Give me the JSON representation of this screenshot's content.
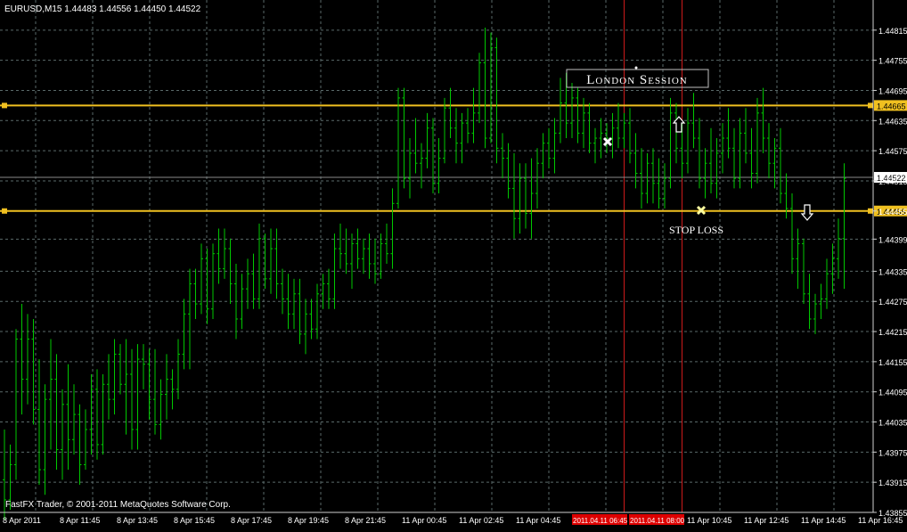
{
  "window": {
    "symbol_header": "EURUSD,M15  1.44483 1.44556 1.44450 1.44522",
    "copyright": "FastFX Trader, © 2001-2011 MetaQuotes Software Corp."
  },
  "colors": {
    "background": "#000000",
    "bars": "#00c800",
    "grid": "#5a6a6a",
    "horizontal_lines": "#f0c020",
    "vertical_lines": "#cc1a1a",
    "axis_text": "#ffffff",
    "highlight_bg": "#dd0000"
  },
  "annotations": {
    "session_label": "London Session",
    "stop_loss_label": "STOP LOSS",
    "cross_marker_1": "white-x-icon",
    "cross_marker_2": "yellow-x-icon",
    "arrow_up": "arrow-up-icon",
    "arrow_down": "arrow-down-icon"
  },
  "chart_data": {
    "type": "ohlc",
    "symbol": "EURUSD",
    "timeframe": "M15",
    "header_values": {
      "open": 1.44483,
      "high": 1.44556,
      "low": 1.4445,
      "close": 1.44522
    },
    "price_ticks": [
      "1.44815",
      "1.44755",
      "1.44695",
      "1.44635",
      "1.44575",
      "1.44515",
      "1.44455",
      "1.44399",
      "1.44335",
      "1.44275",
      "1.44215",
      "1.44155",
      "1.44095",
      "1.44035",
      "1.43975",
      "1.43915",
      "1.43855"
    ],
    "price_range": [
      1.43855,
      1.44875
    ],
    "time_ticks": [
      "8 Apr 2011",
      "8 Apr 11:45",
      "8 Apr 13:45",
      "8 Apr 15:45",
      "8 Apr 17:45",
      "8 Apr 19:45",
      "8 Apr 21:45",
      "11 Apr 00:45",
      "11 Apr 02:45",
      "11 Apr 04:45",
      "2011.04.11 06:45",
      "2011.04.11 08:00",
      "11 Apr 10:45",
      "11 Apr 12:45",
      "11 Apr 14:45",
      "11 Apr 16:45"
    ],
    "horizontal_lines": [
      {
        "price": 1.44665,
        "label": "1.44665"
      },
      {
        "price": 1.44455,
        "label": "1.44455"
      }
    ],
    "current_price": {
      "price": 1.44522,
      "label": "1.44522"
    },
    "vertical_lines": [
      {
        "bar": 107
      },
      {
        "bar": 117
      }
    ],
    "grid": true,
    "bars": [
      [
        1.4392,
        1.4402,
        1.4384,
        1.4388
      ],
      [
        1.4388,
        1.4399,
        1.4386,
        1.4395
      ],
      [
        1.4395,
        1.4422,
        1.4392,
        1.442
      ],
      [
        1.442,
        1.4427,
        1.4405,
        1.4412
      ],
      [
        1.4412,
        1.4425,
        1.4407,
        1.442
      ],
      [
        1.442,
        1.4424,
        1.4403,
        1.4406
      ],
      [
        1.4406,
        1.4416,
        1.4391,
        1.4394
      ],
      [
        1.4394,
        1.4411,
        1.4389,
        1.4408
      ],
      [
        1.4408,
        1.442,
        1.4398,
        1.4412
      ],
      [
        1.4412,
        1.4417,
        1.4394,
        1.4398
      ],
      [
        1.4398,
        1.441,
        1.4392,
        1.4407
      ],
      [
        1.4407,
        1.4415,
        1.4394,
        1.44
      ],
      [
        1.44,
        1.4411,
        1.4397,
        1.4405
      ],
      [
        1.4405,
        1.4407,
        1.4391,
        1.4395
      ],
      [
        1.4395,
        1.4406,
        1.4394,
        1.4402
      ],
      [
        1.4402,
        1.4413,
        1.4397,
        1.441
      ],
      [
        1.441,
        1.4414,
        1.4396,
        1.4399
      ],
      [
        1.4399,
        1.4413,
        1.4397,
        1.4411
      ],
      [
        1.4411,
        1.4417,
        1.4404,
        1.4408
      ],
      [
        1.4408,
        1.442,
        1.4405,
        1.4417
      ],
      [
        1.4417,
        1.4419,
        1.4409,
        1.4411
      ],
      [
        1.4411,
        1.442,
        1.4401,
        1.4413
      ],
      [
        1.4413,
        1.4418,
        1.4398,
        1.4402
      ],
      [
        1.4402,
        1.4419,
        1.4398,
        1.4416
      ],
      [
        1.4416,
        1.4419,
        1.441,
        1.4415
      ],
      [
        1.4415,
        1.4418,
        1.4404,
        1.4408
      ],
      [
        1.4408,
        1.4418,
        1.4401,
        1.4403
      ],
      [
        1.4403,
        1.4412,
        1.44,
        1.4409
      ],
      [
        1.4409,
        1.4417,
        1.4404,
        1.4412
      ],
      [
        1.4412,
        1.4414,
        1.4406,
        1.441
      ],
      [
        1.441,
        1.442,
        1.4408,
        1.4417
      ],
      [
        1.4417,
        1.4428,
        1.4414,
        1.4425
      ],
      [
        1.4425,
        1.4434,
        1.4414,
        1.4431
      ],
      [
        1.4431,
        1.4434,
        1.4424,
        1.4427
      ],
      [
        1.4427,
        1.4439,
        1.4425,
        1.4436
      ],
      [
        1.4436,
        1.4438,
        1.4423,
        1.4426
      ],
      [
        1.4426,
        1.4439,
        1.4424,
        1.4437
      ],
      [
        1.4437,
        1.4442,
        1.4431,
        1.4434
      ],
      [
        1.4434,
        1.4442,
        1.4432,
        1.4438
      ],
      [
        1.4438,
        1.444,
        1.4427,
        1.4431
      ],
      [
        1.4431,
        1.4435,
        1.442,
        1.4424
      ],
      [
        1.4424,
        1.4433,
        1.4422,
        1.443
      ],
      [
        1.443,
        1.4436,
        1.4426,
        1.4433
      ],
      [
        1.4433,
        1.4437,
        1.4426,
        1.4428
      ],
      [
        1.4428,
        1.4443,
        1.4426,
        1.444
      ],
      [
        1.444,
        1.4441,
        1.443,
        1.4432
      ],
      [
        1.4432,
        1.4442,
        1.4429,
        1.4438
      ],
      [
        1.4438,
        1.4442,
        1.4428,
        1.4431
      ],
      [
        1.4431,
        1.4434,
        1.4425,
        1.4428
      ],
      [
        1.4428,
        1.4433,
        1.4422,
        1.4425
      ],
      [
        1.4425,
        1.4432,
        1.4422,
        1.4429
      ],
      [
        1.4429,
        1.4432,
        1.4419,
        1.4421
      ],
      [
        1.4421,
        1.4428,
        1.4417,
        1.4425
      ],
      [
        1.4425,
        1.4428,
        1.442,
        1.4422
      ],
      [
        1.4422,
        1.4431,
        1.442,
        1.4429
      ],
      [
        1.4429,
        1.4433,
        1.4426,
        1.4431
      ],
      [
        1.4431,
        1.4434,
        1.4426,
        1.4428
      ],
      [
        1.4428,
        1.4441,
        1.4426,
        1.4438
      ],
      [
        1.4438,
        1.4443,
        1.4434,
        1.4437
      ],
      [
        1.4437,
        1.4442,
        1.4433,
        1.4435
      ],
      [
        1.4435,
        1.4441,
        1.443,
        1.4439
      ],
      [
        1.4439,
        1.4442,
        1.4434,
        1.4436
      ],
      [
        1.4436,
        1.444,
        1.4433,
        1.4438
      ],
      [
        1.4438,
        1.4441,
        1.4432,
        1.4435
      ],
      [
        1.4435,
        1.444,
        1.4431,
        1.4433
      ],
      [
        1.4433,
        1.4441,
        1.4432,
        1.4439
      ],
      [
        1.4439,
        1.4443,
        1.4435,
        1.4437
      ],
      [
        1.4437,
        1.445,
        1.4434,
        1.4447
      ],
      [
        1.4447,
        1.447,
        1.4446,
        1.4468
      ],
      [
        1.4468,
        1.447,
        1.445,
        1.4452
      ],
      [
        1.4452,
        1.446,
        1.4448,
        1.4457
      ],
      [
        1.4457,
        1.4464,
        1.4453,
        1.4455
      ],
      [
        1.4455,
        1.4459,
        1.445,
        1.4456
      ],
      [
        1.4456,
        1.4465,
        1.4454,
        1.4462
      ],
      [
        1.4462,
        1.4464,
        1.4449,
        1.4451
      ],
      [
        1.4451,
        1.446,
        1.4449,
        1.4456
      ],
      [
        1.4456,
        1.4468,
        1.4455,
        1.4466
      ],
      [
        1.4466,
        1.447,
        1.446,
        1.4462
      ],
      [
        1.4462,
        1.4466,
        1.4455,
        1.4459
      ],
      [
        1.4459,
        1.4465,
        1.4455,
        1.4463
      ],
      [
        1.4463,
        1.4466,
        1.4459,
        1.4461
      ],
      [
        1.4461,
        1.447,
        1.4459,
        1.4465
      ],
      [
        1.4465,
        1.4477,
        1.4463,
        1.4475
      ],
      [
        1.4475,
        1.4482,
        1.4458,
        1.446
      ],
      [
        1.446,
        1.4481,
        1.4459,
        1.4478
      ],
      [
        1.4478,
        1.448,
        1.4455,
        1.4458
      ],
      [
        1.4458,
        1.4461,
        1.4452,
        1.4456
      ],
      [
        1.4456,
        1.4459,
        1.4448,
        1.445
      ],
      [
        1.445,
        1.4457,
        1.444,
        1.4444
      ],
      [
        1.4444,
        1.4455,
        1.4441,
        1.4452
      ],
      [
        1.4452,
        1.4455,
        1.4442,
        1.4445
      ],
      [
        1.4445,
        1.4456,
        1.444,
        1.4449
      ],
      [
        1.4449,
        1.4458,
        1.4446,
        1.4455
      ],
      [
        1.4455,
        1.4461,
        1.4452,
        1.4459
      ],
      [
        1.4459,
        1.4462,
        1.4454,
        1.4456
      ],
      [
        1.4456,
        1.4464,
        1.4453,
        1.4461
      ],
      [
        1.4461,
        1.4472,
        1.4459,
        1.4467
      ],
      [
        1.4467,
        1.4473,
        1.446,
        1.4463
      ],
      [
        1.4463,
        1.4471,
        1.446,
        1.4468
      ],
      [
        1.4468,
        1.447,
        1.4459,
        1.4461
      ],
      [
        1.4461,
        1.4468,
        1.4458,
        1.4465
      ],
      [
        1.4465,
        1.4467,
        1.4457,
        1.4459
      ],
      [
        1.4459,
        1.4462,
        1.4455,
        1.446
      ],
      [
        1.446,
        1.4464,
        1.4456,
        1.4461
      ],
      [
        1.4461,
        1.4463,
        1.4457,
        1.446
      ],
      [
        1.446,
        1.4465,
        1.4456,
        1.4462
      ],
      [
        1.4462,
        1.4467,
        1.4458,
        1.446
      ],
      [
        1.446,
        1.4465,
        1.4458,
        1.4463
      ],
      [
        1.4463,
        1.4466,
        1.4455,
        1.4457
      ],
      [
        1.4457,
        1.4461,
        1.445,
        1.4453
      ],
      [
        1.4453,
        1.4458,
        1.4446,
        1.4449
      ],
      [
        1.4449,
        1.4457,
        1.4447,
        1.4455
      ],
      [
        1.4455,
        1.4458,
        1.4447,
        1.4451
      ],
      [
        1.4451,
        1.4456,
        1.4446,
        1.4448
      ],
      [
        1.4448,
        1.4455,
        1.4446,
        1.4452
      ],
      [
        1.4452,
        1.4468,
        1.445,
        1.4465
      ],
      [
        1.4465,
        1.4467,
        1.4455,
        1.4458
      ],
      [
        1.4458,
        1.4463,
        1.4452,
        1.4455
      ],
      [
        1.4455,
        1.4466,
        1.4453,
        1.4463
      ],
      [
        1.4463,
        1.4469,
        1.4458,
        1.446
      ],
      [
        1.446,
        1.4464,
        1.445,
        1.4452
      ],
      [
        1.4452,
        1.4458,
        1.4448,
        1.4455
      ],
      [
        1.4455,
        1.4462,
        1.4449,
        1.4451
      ],
      [
        1.4451,
        1.446,
        1.4448,
        1.4457
      ],
      [
        1.4457,
        1.4463,
        1.4453,
        1.446
      ],
      [
        1.446,
        1.4466,
        1.4456,
        1.4458
      ],
      [
        1.4458,
        1.4462,
        1.445,
        1.4452
      ],
      [
        1.4452,
        1.4464,
        1.445,
        1.4461
      ],
      [
        1.4461,
        1.4466,
        1.4455,
        1.4457
      ],
      [
        1.4457,
        1.4462,
        1.445,
        1.4453
      ],
      [
        1.4453,
        1.4468,
        1.4451,
        1.4465
      ],
      [
        1.4465,
        1.447,
        1.4457,
        1.446
      ],
      [
        1.446,
        1.4463,
        1.4452,
        1.4455
      ],
      [
        1.4455,
        1.446,
        1.445,
        1.4458
      ],
      [
        1.4458,
        1.4462,
        1.4447,
        1.4449
      ],
      [
        1.4449,
        1.4453,
        1.4444,
        1.4446
      ],
      [
        1.4446,
        1.4449,
        1.4433,
        1.4436
      ],
      [
        1.4436,
        1.4442,
        1.443,
        1.4439
      ],
      [
        1.4439,
        1.444,
        1.4427,
        1.4429
      ],
      [
        1.4429,
        1.4433,
        1.4422,
        1.4424
      ],
      [
        1.4424,
        1.4429,
        1.4421,
        1.4427
      ],
      [
        1.4427,
        1.4431,
        1.4424,
        1.4428
      ],
      [
        1.4428,
        1.4436,
        1.4426,
        1.4433
      ],
      [
        1.4433,
        1.4439,
        1.4429,
        1.4436
      ],
      [
        1.4436,
        1.4444,
        1.4432,
        1.444
      ],
      [
        1.444,
        1.4455,
        1.443,
        1.4452
      ]
    ]
  }
}
